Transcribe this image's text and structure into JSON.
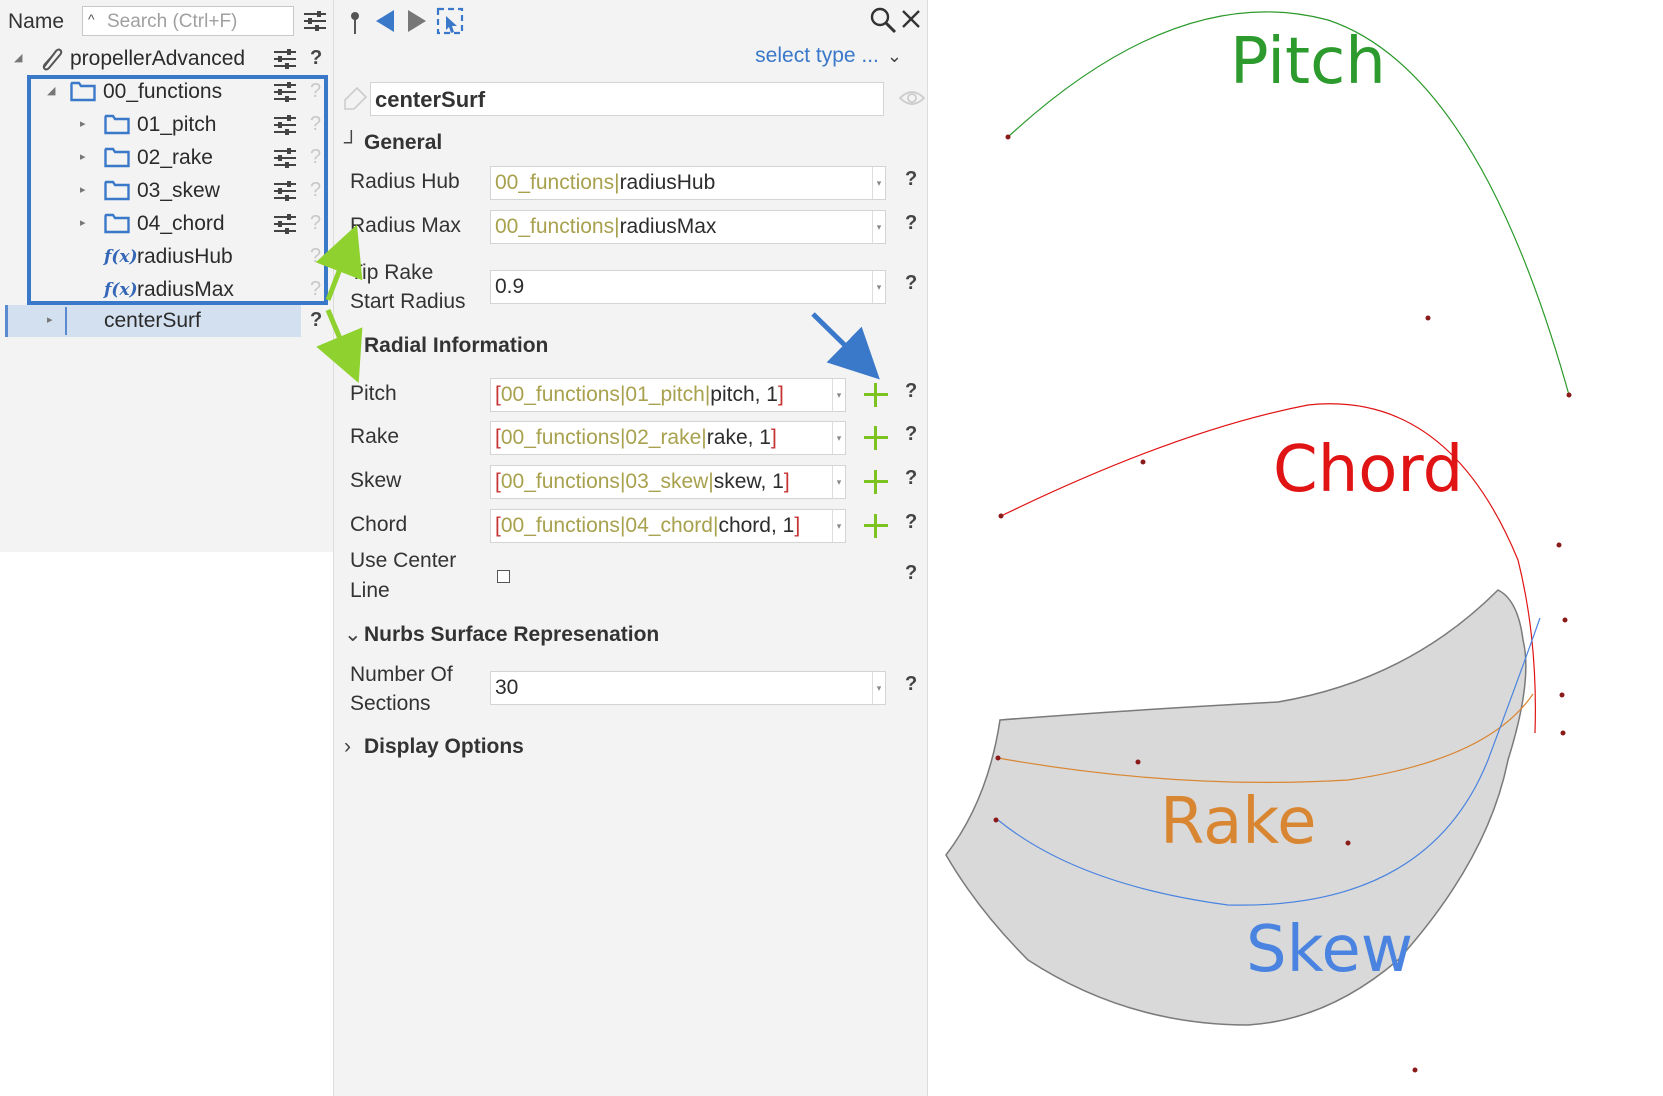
{
  "tree": {
    "header_label": "Name",
    "search_placeholder": "Search (Ctrl+F)",
    "items": [
      {
        "label": "propellerAdvanced"
      },
      {
        "label": "00_functions"
      },
      {
        "label": "01_pitch"
      },
      {
        "label": "02_rake"
      },
      {
        "label": "03_skew"
      },
      {
        "label": "04_chord"
      },
      {
        "label": "radiusHub",
        "icon_text": "f(x)"
      },
      {
        "label": "radiusMax",
        "icon_text": "f(x)"
      },
      {
        "label": "centerSurf"
      }
    ],
    "help_glyph": "?"
  },
  "props": {
    "select_type": "select type ...",
    "name": "centerSurf",
    "general": {
      "title": "General",
      "radius_hub": {
        "label": "Radius Hub",
        "ref": "00_functions",
        "sep": "|",
        "value": "radiusHub"
      },
      "radius_max": {
        "label": "Radius Max",
        "ref": "00_functions",
        "sep": "|",
        "value": "radiusMax"
      },
      "tip_rake_label_1": "Tip Rake",
      "tip_rake_label_2": "Start Radius",
      "tip_rake_value": "0.9"
    },
    "radial": {
      "title": "Radial Information",
      "rows": [
        {
          "label": "Pitch",
          "open": "[",
          "ref1": "00_functions",
          "sep1": "|",
          "ref2": "01_pitch",
          "sep2": "|",
          "val": "pitch, 1",
          "close": "]"
        },
        {
          "label": "Rake",
          "open": "[",
          "ref1": "00_functions",
          "sep1": "|",
          "ref2": "02_rake",
          "sep2": "|",
          "val": "rake, 1",
          "close": "]"
        },
        {
          "label": "Skew",
          "open": "[",
          "ref1": "00_functions",
          "sep1": "|",
          "ref2": "03_skew",
          "sep2": "|",
          "val": "skew, 1",
          "close": "]"
        },
        {
          "label": "Chord",
          "open": "[",
          "ref1": "00_functions",
          "sep1": "|",
          "ref2": "04_chord",
          "sep2": "|",
          "val": "chord, 1",
          "close": "]"
        }
      ],
      "use_center_line_1": "Use Center",
      "use_center_line_2": "Line"
    },
    "nurbs": {
      "title": "Nurbs Surface Represenation",
      "sections_label_1": "Number Of",
      "sections_label_2": "Sections",
      "sections_value": "30"
    },
    "display": {
      "title": "Display Options"
    },
    "help_glyph": "?"
  },
  "viewport": {
    "labels": {
      "pitch": "Pitch",
      "chord": "Chord",
      "rake": "Rake",
      "skew": "Skew"
    },
    "colors": {
      "pitch": "#2c9a2c",
      "chord": "#e01414",
      "rake": "#d98632",
      "skew": "#4a84e0",
      "surface": "#d9d9d9"
    }
  },
  "colors": {
    "accent_blue": "#3a78c9",
    "accent_green": "#8fd12e",
    "add_green": "#7cc322"
  }
}
